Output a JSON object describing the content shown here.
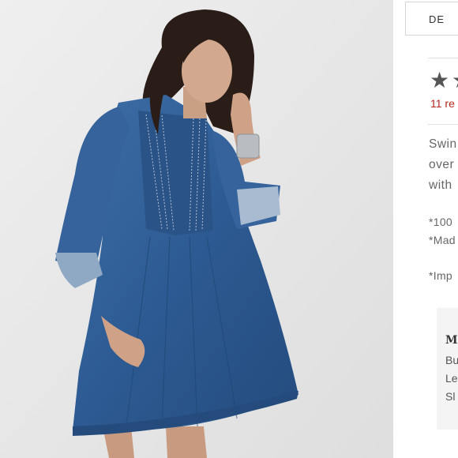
{
  "photo": {
    "alt_subject": "model-in-denim-tunic"
  },
  "tabs": [
    {
      "label": "DE"
    }
  ],
  "rating": {
    "stars_visible": 2,
    "reviews_text": "11 re"
  },
  "description": {
    "lines": [
      "Swin",
      "over",
      "with"
    ]
  },
  "notes": [
    "*100",
    "*Mad",
    "*Imp"
  ],
  "info_box": {
    "title": "M",
    "items": [
      "Bu",
      "Le",
      "Sl"
    ]
  },
  "colors": {
    "accent": "#b3261e",
    "text": "#666666",
    "denim": "#2f5b8f",
    "background": "#e7e7e7"
  }
}
